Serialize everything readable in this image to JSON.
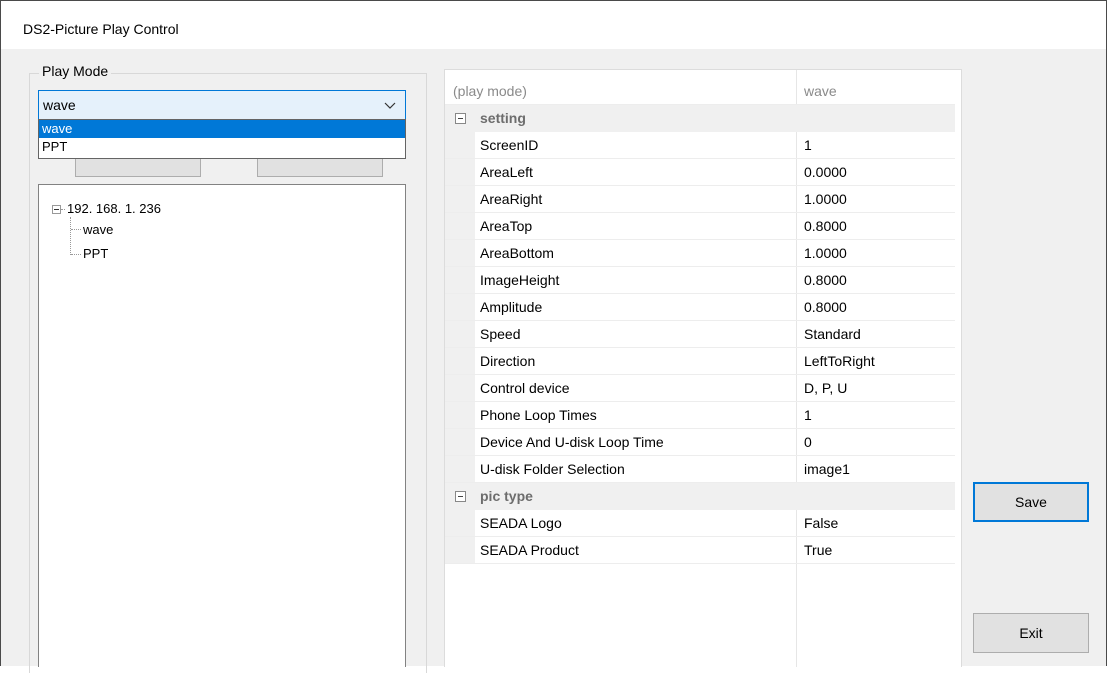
{
  "window": {
    "title": "DS2-Picture Play Control"
  },
  "play_mode": {
    "group_label": "Play Mode",
    "selected": "wave",
    "options": [
      "wave",
      "PPT"
    ]
  },
  "tree": {
    "root": "192. 168. 1. 236",
    "children": [
      "wave",
      "PPT"
    ]
  },
  "grid": {
    "header": {
      "key": "(play mode)",
      "value": "wave"
    },
    "categories": [
      {
        "name": "setting",
        "rows": [
          {
            "key": "ScreenID",
            "value": "1"
          },
          {
            "key": "AreaLeft",
            "value": "0.0000"
          },
          {
            "key": "AreaRight",
            "value": "1.0000"
          },
          {
            "key": "AreaTop",
            "value": "0.8000"
          },
          {
            "key": "AreaBottom",
            "value": "1.0000"
          },
          {
            "key": "ImageHeight",
            "value": "0.8000"
          },
          {
            "key": "Amplitude",
            "value": "0.8000"
          },
          {
            "key": "Speed",
            "value": "Standard"
          },
          {
            "key": "Direction",
            "value": "LeftToRight"
          },
          {
            "key": "Control device",
            "value": "D, P, U"
          },
          {
            "key": "Phone Loop Times",
            "value": "1"
          },
          {
            "key": "Device And U-disk Loop Time",
            "value": "0"
          },
          {
            "key": "U-disk Folder Selection",
            "value": "image1"
          }
        ]
      },
      {
        "name": "pic type",
        "rows": [
          {
            "key": "SEADA Logo",
            "value": "False"
          },
          {
            "key": "SEADA Product",
            "value": "True"
          }
        ]
      }
    ]
  },
  "buttons": {
    "save": "Save",
    "exit": "Exit"
  },
  "colors": {
    "accent": "#0078d7",
    "selection": "#0078d7",
    "combo_bg": "#e5f1fb"
  }
}
